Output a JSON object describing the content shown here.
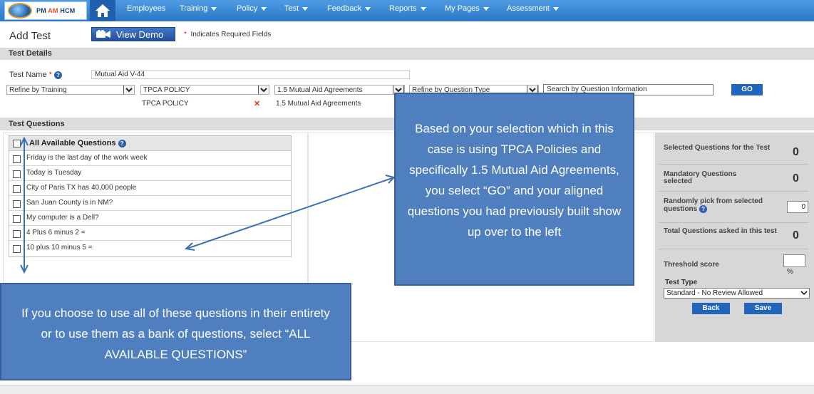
{
  "nav": {
    "logo_text_pre": "PM",
    "logo_text_am": "AM",
    "logo_text_post": "HCM",
    "items": [
      {
        "label": "Employees",
        "caret": false
      },
      {
        "label": "Training",
        "caret": true
      },
      {
        "label": "Policy",
        "caret": true
      },
      {
        "label": "Test",
        "caret": true
      },
      {
        "label": "Feedback",
        "caret": true
      },
      {
        "label": "Reports",
        "caret": true
      },
      {
        "label": "My Pages",
        "caret": true
      },
      {
        "label": "Assessment",
        "caret": true
      }
    ]
  },
  "header": {
    "title": "Add Test",
    "view_demo_label": "View Demo",
    "required_star": "*",
    "required_note": "Indicates Required Fields"
  },
  "test_details": {
    "section_title": "Test Details",
    "test_name_label": "Test Name",
    "test_name_star": "*",
    "test_name_value": "Mutual Aid V-44",
    "refine_training": "Refine by Training",
    "policy_select": "TPCA POLICY",
    "agreement_select": "1.5 Mutual Aid Agreements",
    "refine_question_type": "Refine by Question Type",
    "search_placeholder": "Search by Question Information",
    "go_label": "GO",
    "chip_policy": "TPCA POLICY",
    "chip_agreement": "1.5 Mutual Aid Agreements",
    "chip_remove": "✕"
  },
  "test_questions": {
    "section_title": "Test Questions",
    "all_available_label": "All Available Questions",
    "questions": [
      "Friday is the last day of the work week",
      "Today is Tuesday",
      "City of Paris TX has 40,000 people",
      "San Juan County is in NM?",
      "My computer is a Dell?",
      "4 Plus 6 minus 2 =",
      "10 plus 10 minus 5 ="
    ]
  },
  "summary": {
    "selected_label": "Selected Questions for the Test",
    "selected_count": "0",
    "mandatory_label": "Mandatory Questions selected",
    "mandatory_count": "0",
    "random_label": "Randomly pick from selected questions",
    "random_value": "0",
    "total_label": "Total Questions asked in this test",
    "total_count": "0",
    "threshold_label": "Threshold score",
    "percent": "%",
    "test_type_label": "Test Type",
    "test_type_value": "Standard - No Review Allowed",
    "back_label": "Back",
    "save_label": "Save"
  },
  "callouts": {
    "right_text": "Based on your selection which in this case is using TPCA Policies and specifically 1.5 Mutual Aid Agreements, you select “GO” and your aligned questions you had previously built show up over to the left",
    "left_text": "If you choose to use all of these questions in their entirety or to use them as a bank of questions, select “ALL AVAILABLE QUESTIONS”"
  },
  "colors": {
    "nav_blue": "#2a77c9",
    "button_blue": "#2266bb",
    "callout_blue": "#4f7fbf",
    "remove_red": "#d43a1a"
  },
  "help_glyph": "?"
}
